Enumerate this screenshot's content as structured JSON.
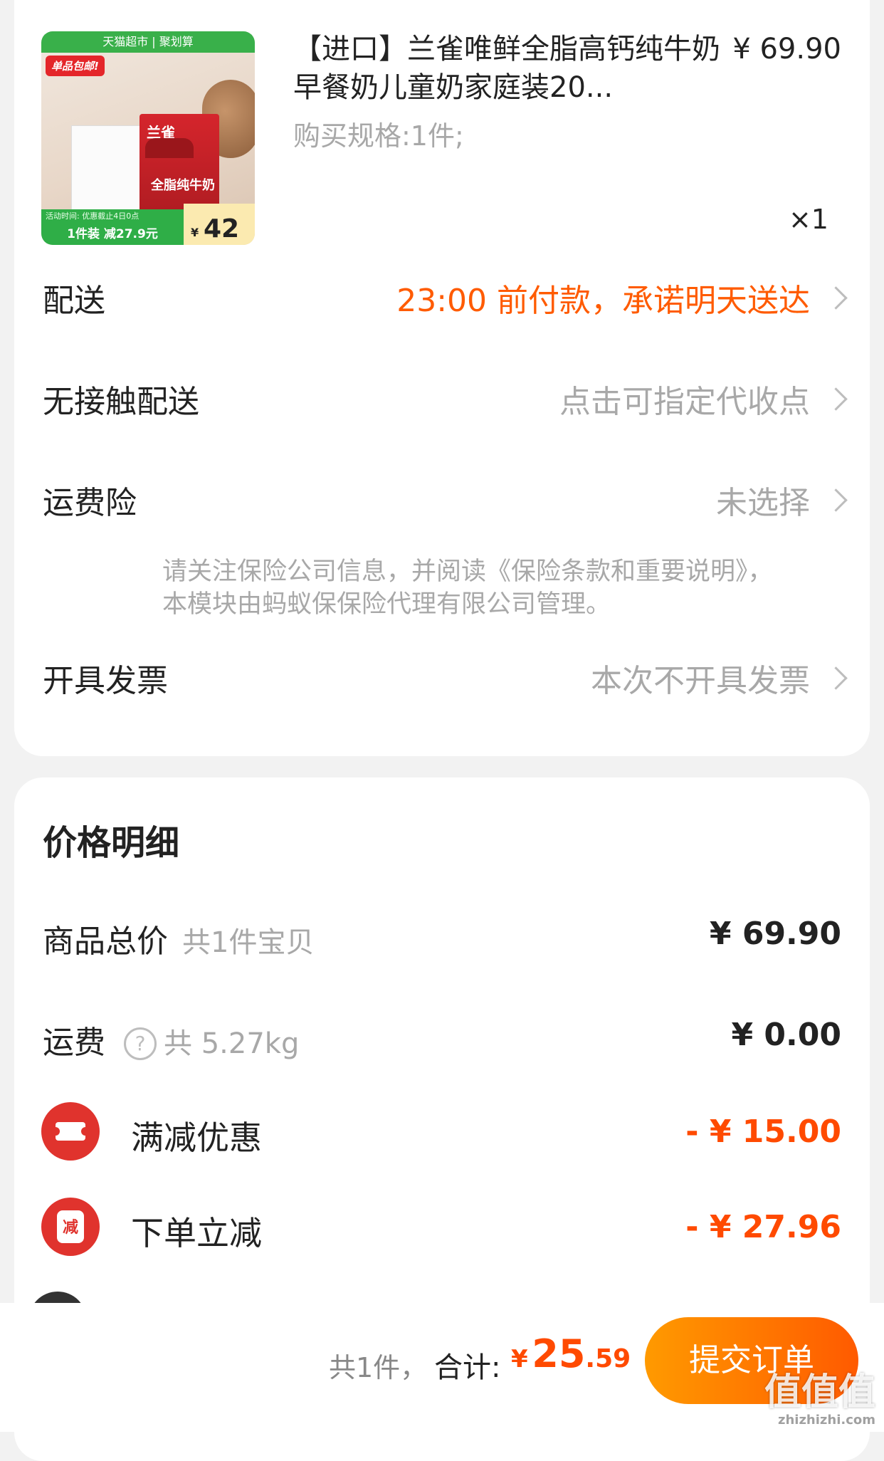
{
  "product": {
    "title": "【进口】兰雀唯鲜全脂高钙纯牛奶早餐奶儿童奶家庭装20...",
    "price": "¥ 69.90",
    "spec": "购买规格:1件;",
    "qty": "×1",
    "thumb": {
      "top_banner": "天猫超市 | 聚划算",
      "tag": "单品包邮!",
      "brand": "兰雀",
      "carton_text": "全脂纯牛奶",
      "activity_time": "活动时间: 优惠截止4日0点",
      "deal": "1件装 减27.9元",
      "price_currency": "¥",
      "price": "42"
    }
  },
  "rows": {
    "delivery": {
      "label": "配送",
      "value": "23:00 前付款，承诺明天送达"
    },
    "contactless": {
      "label": "无接触配送",
      "value": "点击可指定代收点"
    },
    "shipping_insurance": {
      "label": "运费险",
      "value": "未选择",
      "note": "请关注保险公司信息，并阅读《保险条款和重要说明》，本模块由蚂蚁保保险代理有限公司管理。"
    },
    "invoice": {
      "label": "开具发票",
      "value": "本次不开具发票"
    }
  },
  "price_detail": {
    "title": "价格明细",
    "goods_total": {
      "label": "商品总价",
      "sub": "共1件宝贝",
      "amount": "¥ 69.90"
    },
    "shipping": {
      "label": "运费",
      "help_icon": "?",
      "sub": "共 5.27kg",
      "amount": "¥ 0.00"
    },
    "full_reduction": {
      "label": "满减优惠",
      "amount": "- ¥ 15.00"
    },
    "order_instant": {
      "label": "下单立减",
      "icon_text": "减",
      "amount": "- ¥ 27.96"
    }
  },
  "bottom_bar": {
    "count": "共1件，",
    "total_label": "合计:",
    "currency": "¥",
    "total_int": "25",
    "total_dec": ".59",
    "submit_label": "提交订单"
  },
  "watermark": {
    "main": "值值值",
    "sub": "zhizhizhi.com"
  },
  "colors": {
    "accent_orange": "#ff5b00",
    "discount_red": "#ff4a00",
    "button_start": "#ff9a00",
    "button_end": "#ff5a00"
  }
}
